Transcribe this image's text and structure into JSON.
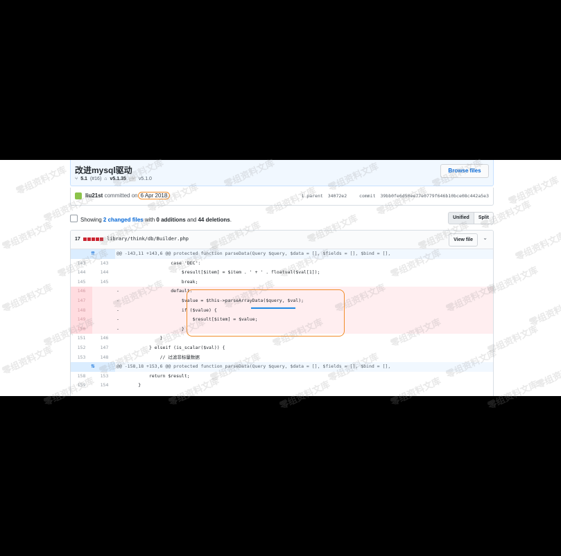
{
  "commit": {
    "title": "改进mysql驱动",
    "branch_icon": "branch-icon",
    "branch": "5.1",
    "pr": "(#16)",
    "tag_icon": "tag-icon",
    "tag1": "v5.1.35",
    "ellipsis": "···",
    "tag2": "v5.1.0",
    "browse_label": "Browse files",
    "author": "liu21st",
    "committed_text": "committed on",
    "date": "6 Apr 2018",
    "parent_label": "1 parent",
    "parent_sha": "34072e2",
    "commit_label": "commit",
    "commit_sha": "39bb0fe6d50ee77e0779f646b10bce08c442a5e3"
  },
  "toc": {
    "showing": "Showing",
    "changed_files": "2 changed files",
    "with": "with",
    "additions": "0 additions",
    "and": "and",
    "deletions": "44 deletions",
    "period": ".",
    "unified_label": "Unified",
    "split_label": "Split"
  },
  "file": {
    "count": "17",
    "path": "library/think/db/Builder.php",
    "view_label": "View file",
    "chevron_icon": "chevron-down-icon"
  },
  "diff": [
    {
      "type": "hunk",
      "ln1": "⇈",
      "ln2": "",
      "code": "@@ -143,11 +143,6 @@ protected function parseData(Query $query, $data = [], $fields = [], $bind = [],"
    },
    {
      "type": "ctx",
      "ln1": "143",
      "ln2": "143",
      "code": "                    case 'DEC':"
    },
    {
      "type": "ctx",
      "ln1": "144",
      "ln2": "144",
      "code": "                        $result[$item] = $item . ' + ' . floatval($val[1]);"
    },
    {
      "type": "ctx",
      "ln1": "145",
      "ln2": "145",
      "code": "                        break;"
    },
    {
      "type": "del",
      "ln1": "146",
      "ln2": "",
      "code": "-                   default:"
    },
    {
      "type": "del",
      "ln1": "147",
      "ln2": "",
      "code": "-                       $value = $this->parseArrayData($query, $val);"
    },
    {
      "type": "del",
      "ln1": "148",
      "ln2": "",
      "code": "-                       if ($value) {"
    },
    {
      "type": "del",
      "ln1": "149",
      "ln2": "",
      "code": "-                           $result[$item] = $value;"
    },
    {
      "type": "del",
      "ln1": "150",
      "ln2": "",
      "code": "-                       }"
    },
    {
      "type": "ctx",
      "ln1": "151",
      "ln2": "146",
      "code": "                }"
    },
    {
      "type": "ctx",
      "ln1": "152",
      "ln2": "147",
      "code": "            } elseif (is_scalar($val)) {"
    },
    {
      "type": "ctx",
      "ln1": "153",
      "ln2": "148",
      "code": "                // 过滤非标量数据"
    },
    {
      "type": "hunk",
      "ln1": "⇅",
      "ln2": "",
      "code": "@@ -158,18 +153,6 @@ protected function parseData(Query $query, $data = [], $fields = [], $bind = [],"
    },
    {
      "type": "ctx",
      "ln1": "158",
      "ln2": "153",
      "code": "            return $result;"
    },
    {
      "type": "ctx",
      "ln1": "159",
      "ln2": "154",
      "code": "        }"
    }
  ],
  "watermark": "零组资料文库"
}
